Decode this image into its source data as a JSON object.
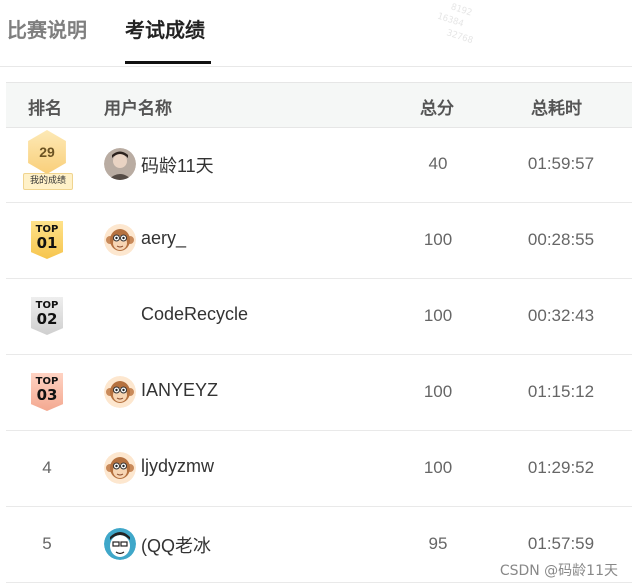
{
  "tabs": {
    "rules": "比赛说明",
    "scores": "考试成绩"
  },
  "table": {
    "headers": {
      "rank": "排名",
      "user": "用户名称",
      "score": "总分",
      "time": "总耗时"
    },
    "my_row": {
      "rank": "29",
      "badge_label": "我的成绩",
      "name": "码龄11天",
      "score": "40",
      "time": "01:59:57",
      "avatar_icon": "user-photo-avatar"
    },
    "rows": [
      {
        "badge_top": "TOP",
        "badge_num": "01",
        "name": "aery_",
        "score": "100",
        "time": "00:28:55",
        "avatar_icon": "monkey-avatar"
      },
      {
        "badge_top": "TOP",
        "badge_num": "02",
        "name": "CodeRecycle",
        "score": "100",
        "time": "00:32:43"
      },
      {
        "badge_top": "TOP",
        "badge_num": "03",
        "name": "IANYEYZ",
        "score": "100",
        "time": "01:15:12",
        "avatar_icon": "monkey-avatar"
      },
      {
        "rank": "4",
        "name": "ljydyzmw",
        "score": "100",
        "time": "01:29:52",
        "avatar_icon": "monkey-avatar"
      },
      {
        "rank": "5",
        "name": "(QQ老冰",
        "score": "95",
        "time": "01:57:59",
        "avatar_icon": "cartoon-avatar"
      }
    ]
  },
  "watermark": [
    "4096",
    "8192",
    "16384",
    "32768",
    "512",
    "64",
    "128"
  ],
  "credit": "CSDN @码龄11天",
  "colors": {
    "gold": "#f6c54e",
    "silver": "#cfcfcf",
    "bronze": "#f3a890",
    "header_bg": "#f5f7f6"
  }
}
